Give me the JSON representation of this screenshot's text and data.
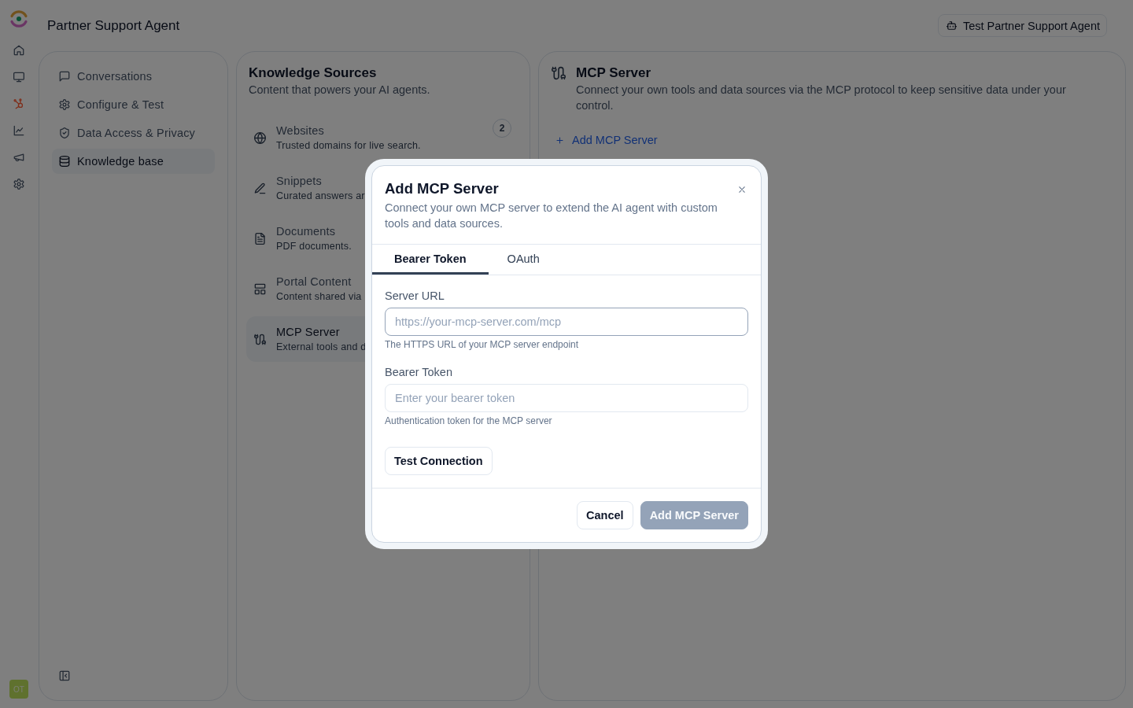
{
  "app_rail": {
    "avatar_initials": "OT"
  },
  "header": {
    "title": "Partner Support Agent",
    "test_button": "Test Partner Support Agent"
  },
  "sidebar": {
    "items": [
      {
        "label": "Conversations",
        "selected": false
      },
      {
        "label": "Configure & Test",
        "selected": false
      },
      {
        "label": "Data Access & Privacy",
        "selected": false
      },
      {
        "label": "Knowledge base",
        "selected": true
      }
    ]
  },
  "knowledge_sources": {
    "title": "Knowledge Sources",
    "subtitle": "Content that powers your AI agents.",
    "items": [
      {
        "title": "Websites",
        "description": "Trusted domains for live search.",
        "count": "2",
        "selected": false
      },
      {
        "title": "Snippets",
        "description": "Curated answers ar",
        "selected": false
      },
      {
        "title": "Documents",
        "description": "PDF documents.",
        "selected": false
      },
      {
        "title": "Portal Content",
        "description": "Content shared via",
        "selected": false
      },
      {
        "title": "MCP Server",
        "description": "External tools and d",
        "selected": true
      }
    ]
  },
  "mcp_server": {
    "title": "MCP Server",
    "description": "Connect your own tools and data sources via the MCP protocol to keep sensitive data under your control.",
    "add_link": "Add MCP Server"
  },
  "modal": {
    "title": "Add MCP Server",
    "description": "Connect your own MCP server to extend the AI agent with custom tools and data sources.",
    "tabs": [
      {
        "label": "Bearer Token",
        "selected": true
      },
      {
        "label": "OAuth",
        "selected": false
      }
    ],
    "fields": [
      {
        "label": "Server URL",
        "placeholder": "https://your-mcp-server.com/mcp",
        "hint": "The HTTPS URL of your MCP server endpoint",
        "focused": true
      },
      {
        "label": "Bearer Token",
        "placeholder": "Enter your bearer token",
        "hint": "Authentication token for the MCP server",
        "focused": false
      }
    ],
    "test_button": "Test Connection",
    "cancel_button": "Cancel",
    "submit_button": {
      "label": "Add MCP Server",
      "disabled": true
    }
  }
}
